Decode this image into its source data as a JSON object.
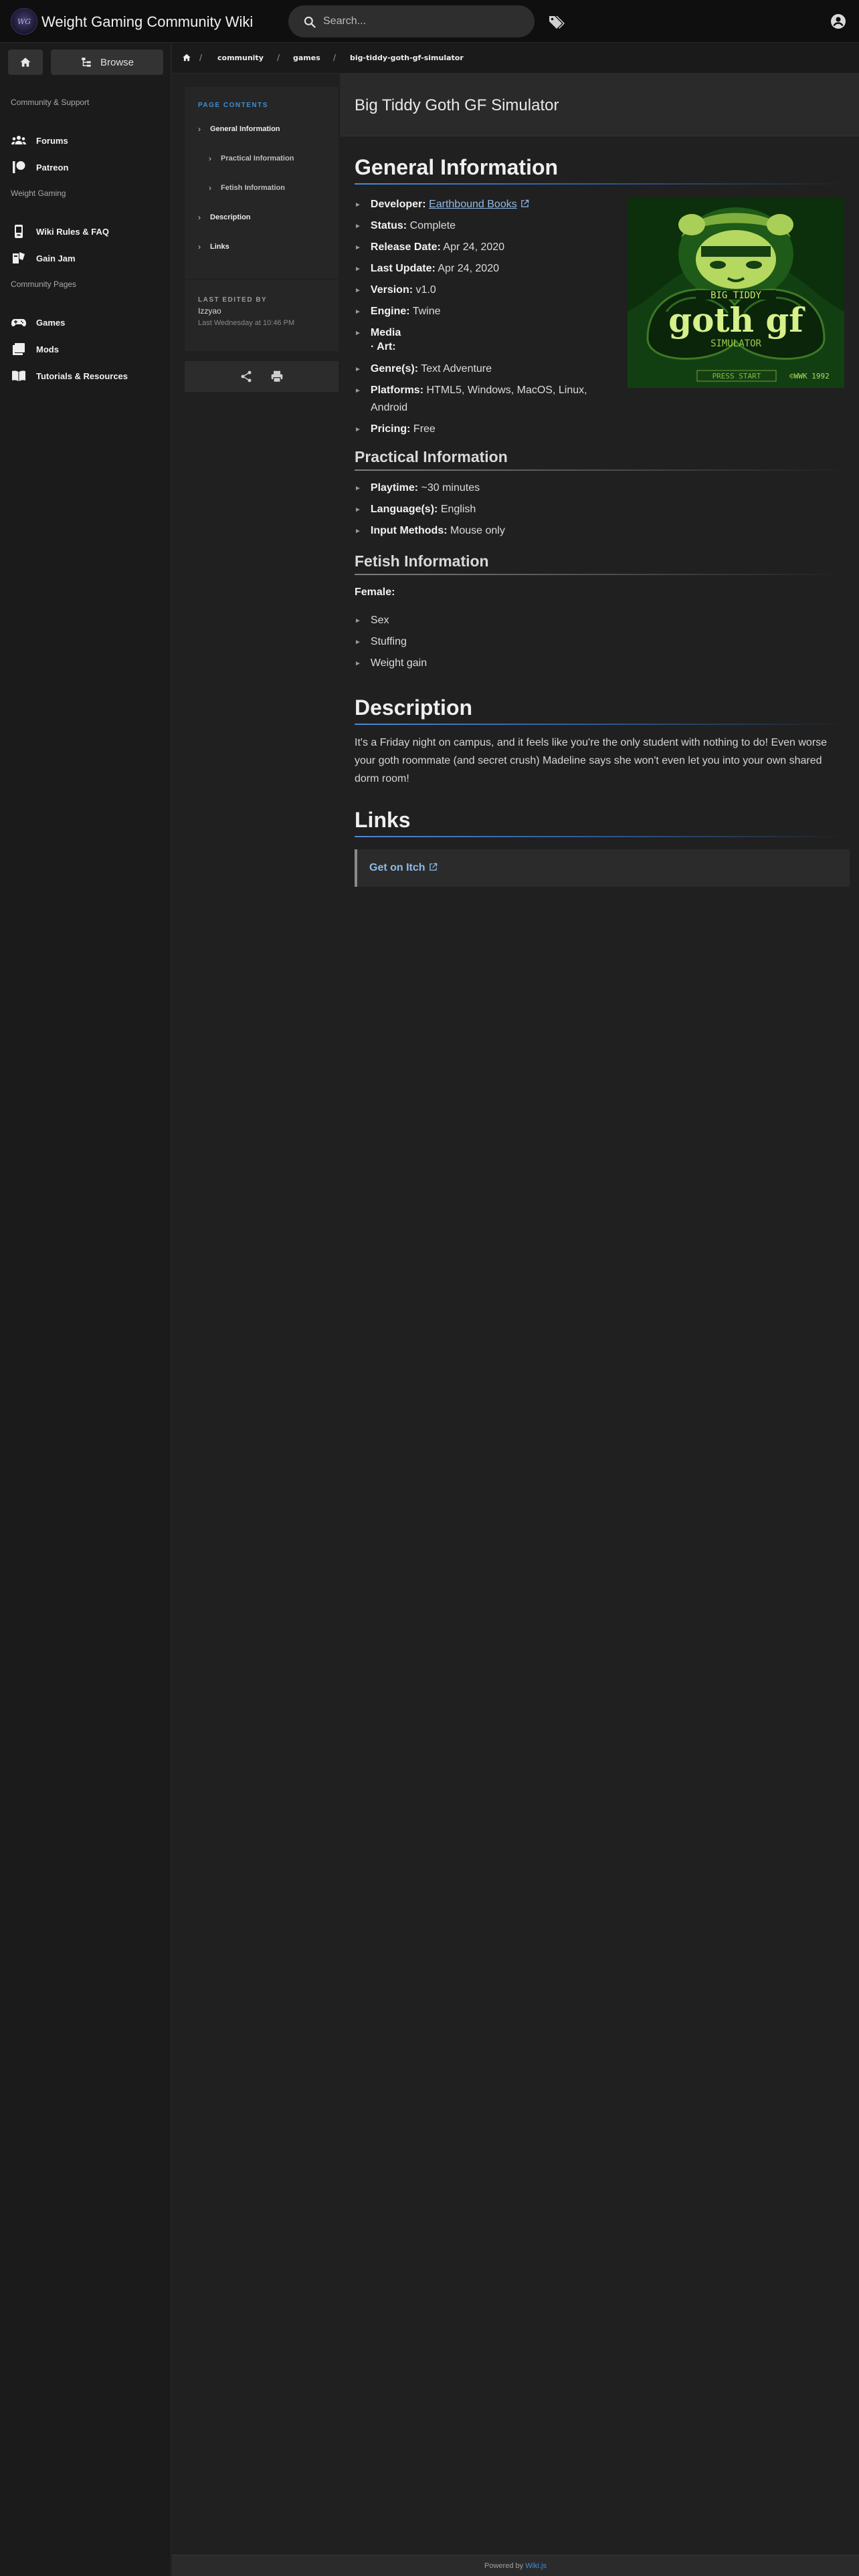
{
  "header": {
    "logo_text": "WG",
    "site_title": "Weight Gaming Community Wiki",
    "search_placeholder": "Search..."
  },
  "leftnav": {
    "browse_label": "Browse",
    "sections": [
      {
        "heading": "Community & Support",
        "items": [
          {
            "label": "Forums",
            "icon": "forums-icon"
          },
          {
            "label": "Patreon",
            "icon": "patreon-icon"
          }
        ]
      },
      {
        "heading": "Weight Gaming",
        "items": [
          {
            "label": "Wiki Rules & FAQ",
            "icon": "rules-icon"
          },
          {
            "label": "Gain Jam",
            "icon": "gain-jam-icon"
          }
        ]
      },
      {
        "heading": "Community Pages",
        "items": [
          {
            "label": "Games",
            "icon": "gamepad-icon"
          },
          {
            "label": "Mods",
            "icon": "mods-icon"
          },
          {
            "label": "Tutorials & Resources",
            "icon": "tutorials-icon"
          }
        ]
      }
    ]
  },
  "breadcrumb": [
    "community",
    "games",
    "big-tiddy-goth-gf-simulator"
  ],
  "toc": {
    "heading": "PAGE CONTENTS",
    "items": [
      {
        "label": "General Information"
      },
      {
        "label": "Practical Information"
      },
      {
        "label": "Fetish Information"
      },
      {
        "label": "Description"
      },
      {
        "label": "Links"
      }
    ],
    "last_edited_label": "LAST EDITED BY",
    "last_edited_user": "Izzyao",
    "last_edited_date": "Last Wednesday at 10:46 PM"
  },
  "page": {
    "title": "Big Tiddy Goth GF Simulator",
    "general": {
      "heading": "General Information",
      "developer_label": "Developer:",
      "developer_value": "Earthbound Books",
      "status_label": "Status:",
      "status_value": "Complete",
      "release_label": "Release Date:",
      "release_value": "Apr 24, 2020",
      "update_label": "Last Update:",
      "update_value": "Apr 24, 2020",
      "version_label": "Version:",
      "version_value": "v1.0",
      "engine_label": "Engine:",
      "engine_value": "Twine",
      "media_label": "Media",
      "art_label": "· Art:",
      "genre_label": "Genre(s):",
      "genre_value": "Text Adventure",
      "platforms_label": "Platforms:",
      "platforms_value_1": "HTML5, Windows, MacOS, Linux,",
      "platforms_value_2": "Android",
      "pricing_label": "Pricing:",
      "pricing_value": "Free"
    },
    "cover": {
      "line1": "BIG TIDDY",
      "line2": "goth gf",
      "line3": "SIMULATOR",
      "press_start": "PRESS START",
      "copyright": "©WWK 1992"
    },
    "practical": {
      "heading": "Practical Information",
      "playtime_label": "Playtime:",
      "playtime_value": "~30 minutes",
      "language_label": "Language(s):",
      "language_value": "English",
      "input_label": "Input Methods:",
      "input_value": "Mouse only"
    },
    "fetish": {
      "heading": "Fetish Information",
      "female_label": "Female:",
      "items": [
        "Sex",
        "Stuffing",
        "Weight gain"
      ]
    },
    "description": {
      "heading": "Description",
      "text": "It's a Friday night on campus, and it feels like you're the only student with nothing to do! Even worse your goth roommate (and secret crush) Madeline says she won't even let you into your own shared dorm room!"
    },
    "links": {
      "heading": "Links",
      "itch_label": "Get on Itch"
    }
  },
  "footer": {
    "prefix": "Powered by",
    "link": "Wiki.js"
  }
}
